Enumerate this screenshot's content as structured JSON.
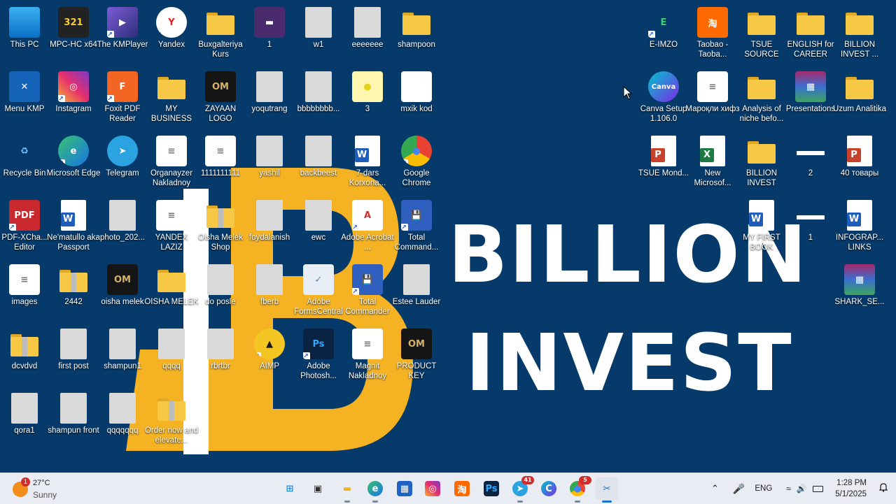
{
  "wallpaper": {
    "brand_line1": "BILLION",
    "brand_line2": "INVEST"
  },
  "desktop_icons": [
    {
      "label": "This PC",
      "type": "monitor",
      "shortcut": false
    },
    {
      "label": "MPC-HC x64",
      "type": "mpc",
      "shortcut": false
    },
    {
      "label": "The KMPlayer",
      "type": "kmplayer",
      "shortcut": true
    },
    {
      "label": "Yandex",
      "type": "yandex",
      "shortcut": true
    },
    {
      "label": "Buxgalteriya Kurs",
      "type": "folder",
      "shortcut": false
    },
    {
      "label": "1",
      "type": "video",
      "shortcut": false
    },
    {
      "label": "w1",
      "type": "photo",
      "shortcut": false
    },
    {
      "label": "eeeeeee",
      "type": "photo",
      "shortcut": false
    },
    {
      "label": "shampoon",
      "type": "folder",
      "shortcut": false
    },
    {
      "label": "Menu KMP",
      "type": "kmp",
      "shortcut": false
    },
    {
      "label": "Instagram",
      "type": "instagram",
      "shortcut": true
    },
    {
      "label": "Foxit PDF Reader",
      "type": "foxit",
      "shortcut": true
    },
    {
      "label": "MY BUSINESS",
      "type": "folder",
      "shortcut": false
    },
    {
      "label": "ZAYAAN LOGO",
      "type": "logo",
      "shortcut": false
    },
    {
      "label": "yoqutrang",
      "type": "photo",
      "shortcut": false
    },
    {
      "label": "bbbbbbbb...",
      "type": "photo",
      "shortcut": false
    },
    {
      "label": "3",
      "type": "lemon",
      "shortcut": false
    },
    {
      "label": "mxik kod",
      "type": "whitebox",
      "shortcut": false
    },
    {
      "label": "Recycle Bin",
      "type": "recycle",
      "shortcut": false
    },
    {
      "label": "Microsoft Edge",
      "type": "edge",
      "shortcut": true
    },
    {
      "label": "Telegram",
      "type": "telegram",
      "shortcut": false
    },
    {
      "label": "Organayzer Nakladnoy",
      "type": "docpage",
      "shortcut": false
    },
    {
      "label": "1111111111",
      "type": "docpage",
      "shortcut": false
    },
    {
      "label": "yashil",
      "type": "photo",
      "shortcut": false
    },
    {
      "label": "backbeest",
      "type": "photo",
      "shortcut": false
    },
    {
      "label": "7-dars Korxona...",
      "type": "word",
      "shortcut": false
    },
    {
      "label": "Google Chrome",
      "type": "chrome",
      "shortcut": true
    },
    {
      "label": "PDF-XCha... Editor",
      "type": "pdfx",
      "shortcut": true
    },
    {
      "label": "Ne'matullo aka Passport",
      "type": "word",
      "shortcut": false
    },
    {
      "label": "photo_202...",
      "type": "photo",
      "shortcut": false
    },
    {
      "label": "YANDEX LAZIZ",
      "type": "docpage",
      "shortcut": false
    },
    {
      "label": "Oisha Melek Shop",
      "type": "zipfolder",
      "shortcut": false
    },
    {
      "label": "foydalanish",
      "type": "photo",
      "shortcut": false
    },
    {
      "label": "ewc",
      "type": "photo",
      "shortcut": false
    },
    {
      "label": "Adobe Acrobat ...",
      "type": "acrobat",
      "shortcut": true
    },
    {
      "label": "Total Command...",
      "type": "totalcmd",
      "shortcut": true
    },
    {
      "label": "images",
      "type": "docpage",
      "shortcut": false
    },
    {
      "label": "2442",
      "type": "zipfolder",
      "shortcut": false
    },
    {
      "label": "oisha melek",
      "type": "logo",
      "shortcut": false
    },
    {
      "label": "OISHA MELEK",
      "type": "folder",
      "shortcut": false
    },
    {
      "label": "do posle",
      "type": "photo",
      "shortcut": false
    },
    {
      "label": "fberb",
      "type": "photo",
      "shortcut": false
    },
    {
      "label": "Adobe FormsCentral",
      "type": "forms",
      "shortcut": false
    },
    {
      "label": "Total Commander",
      "type": "totalcmd",
      "shortcut": true
    },
    {
      "label": "Estee Lauder",
      "type": "photo",
      "shortcut": false
    },
    {
      "label": "dcvdvd",
      "type": "zipfolder",
      "shortcut": false
    },
    {
      "label": "first post",
      "type": "photo",
      "shortcut": false
    },
    {
      "label": "shampun1",
      "type": "photo",
      "shortcut": false
    },
    {
      "label": "qqqq",
      "type": "photo",
      "shortcut": false
    },
    {
      "label": "rbrtbr",
      "type": "photo",
      "shortcut": false
    },
    {
      "label": "AIMP",
      "type": "aimp",
      "shortcut": true
    },
    {
      "label": "Adobe Photosh...",
      "type": "photoshop",
      "shortcut": true
    },
    {
      "label": "Magnit Nakladnoy",
      "type": "docpage",
      "shortcut": false
    },
    {
      "label": "PRODUCT KEY",
      "type": "logo",
      "shortcut": false
    },
    {
      "label": "qora1",
      "type": "photo",
      "shortcut": false
    },
    {
      "label": "shampun front",
      "type": "photo",
      "shortcut": false
    },
    {
      "label": "qqqqqqq",
      "type": "photo",
      "shortcut": false
    },
    {
      "label": "Order now and elevate...",
      "type": "zipfolder",
      "shortcut": false
    },
    {
      "label": "E-IMZO",
      "type": "eimzo",
      "shortcut": true
    },
    {
      "label": "Taobao - Taoba...",
      "type": "taobao",
      "shortcut": false
    },
    {
      "label": "TSUE SOURCE",
      "type": "folder",
      "shortcut": false
    },
    {
      "label": "ENGLISH for CAREER",
      "type": "folder",
      "shortcut": false
    },
    {
      "label": "BILLION INVEST ...",
      "type": "folder",
      "shortcut": false
    },
    {
      "label": "Canva Setup 1.106.0",
      "type": "canva",
      "shortcut": false
    },
    {
      "label": "Мароқли хифз",
      "type": "docpage",
      "shortcut": false
    },
    {
      "label": "Analysis of niche befo...",
      "type": "folder",
      "shortcut": false
    },
    {
      "label": "Presentations",
      "type": "winrar",
      "shortcut": false
    },
    {
      "label": "Uzum Analitika",
      "type": "folder",
      "shortcut": false
    },
    {
      "label": "TSUE Mond...",
      "type": "ppt",
      "shortcut": false
    },
    {
      "label": "New Microsof...",
      "type": "excel",
      "shortcut": false
    },
    {
      "label": "BILLION INVEST",
      "type": "folder",
      "shortcut": false
    },
    {
      "label": "2",
      "type": "bar",
      "shortcut": false
    },
    {
      "label": "40 товары",
      "type": "ppt",
      "shortcut": false
    },
    {
      "label": "MY FIRST BOOK",
      "type": "word",
      "shortcut": false
    },
    {
      "label": "1",
      "type": "bar",
      "shortcut": false
    },
    {
      "label": "INFOGRAP... LINKS",
      "type": "word",
      "shortcut": false
    },
    {
      "label": "SHARK_SE...",
      "type": "winrar",
      "shortcut": false
    }
  ],
  "taskbar": {
    "weather": {
      "temp": "27°C",
      "desc": "Sunny",
      "badge": "1"
    },
    "apps": [
      {
        "name": "Start",
        "icon": "windows-icon"
      },
      {
        "name": "Task View",
        "icon": "task-view-icon"
      },
      {
        "name": "File Explorer",
        "icon": "folder-icon"
      },
      {
        "name": "Microsoft Edge",
        "icon": "edge-icon"
      },
      {
        "name": "Microsoft Store",
        "icon": "store-icon"
      },
      {
        "name": "Instagram",
        "icon": "instagram-icon"
      },
      {
        "name": "Taobao",
        "icon": "taobao-icon"
      },
      {
        "name": "Photoshop",
        "icon": "photoshop-icon",
        "text": "Ps"
      },
      {
        "name": "Telegram",
        "icon": "telegram-icon",
        "badge": "41"
      },
      {
        "name": "Canva",
        "icon": "canva-icon",
        "text": "C"
      },
      {
        "name": "Chrome",
        "icon": "chrome-icon",
        "badge": "5"
      },
      {
        "name": "Snipping Tool",
        "icon": "snipping-tool-icon"
      }
    ],
    "tray": {
      "language": "ENG",
      "time": "1:28 PM",
      "date": "5/1/2025"
    }
  }
}
